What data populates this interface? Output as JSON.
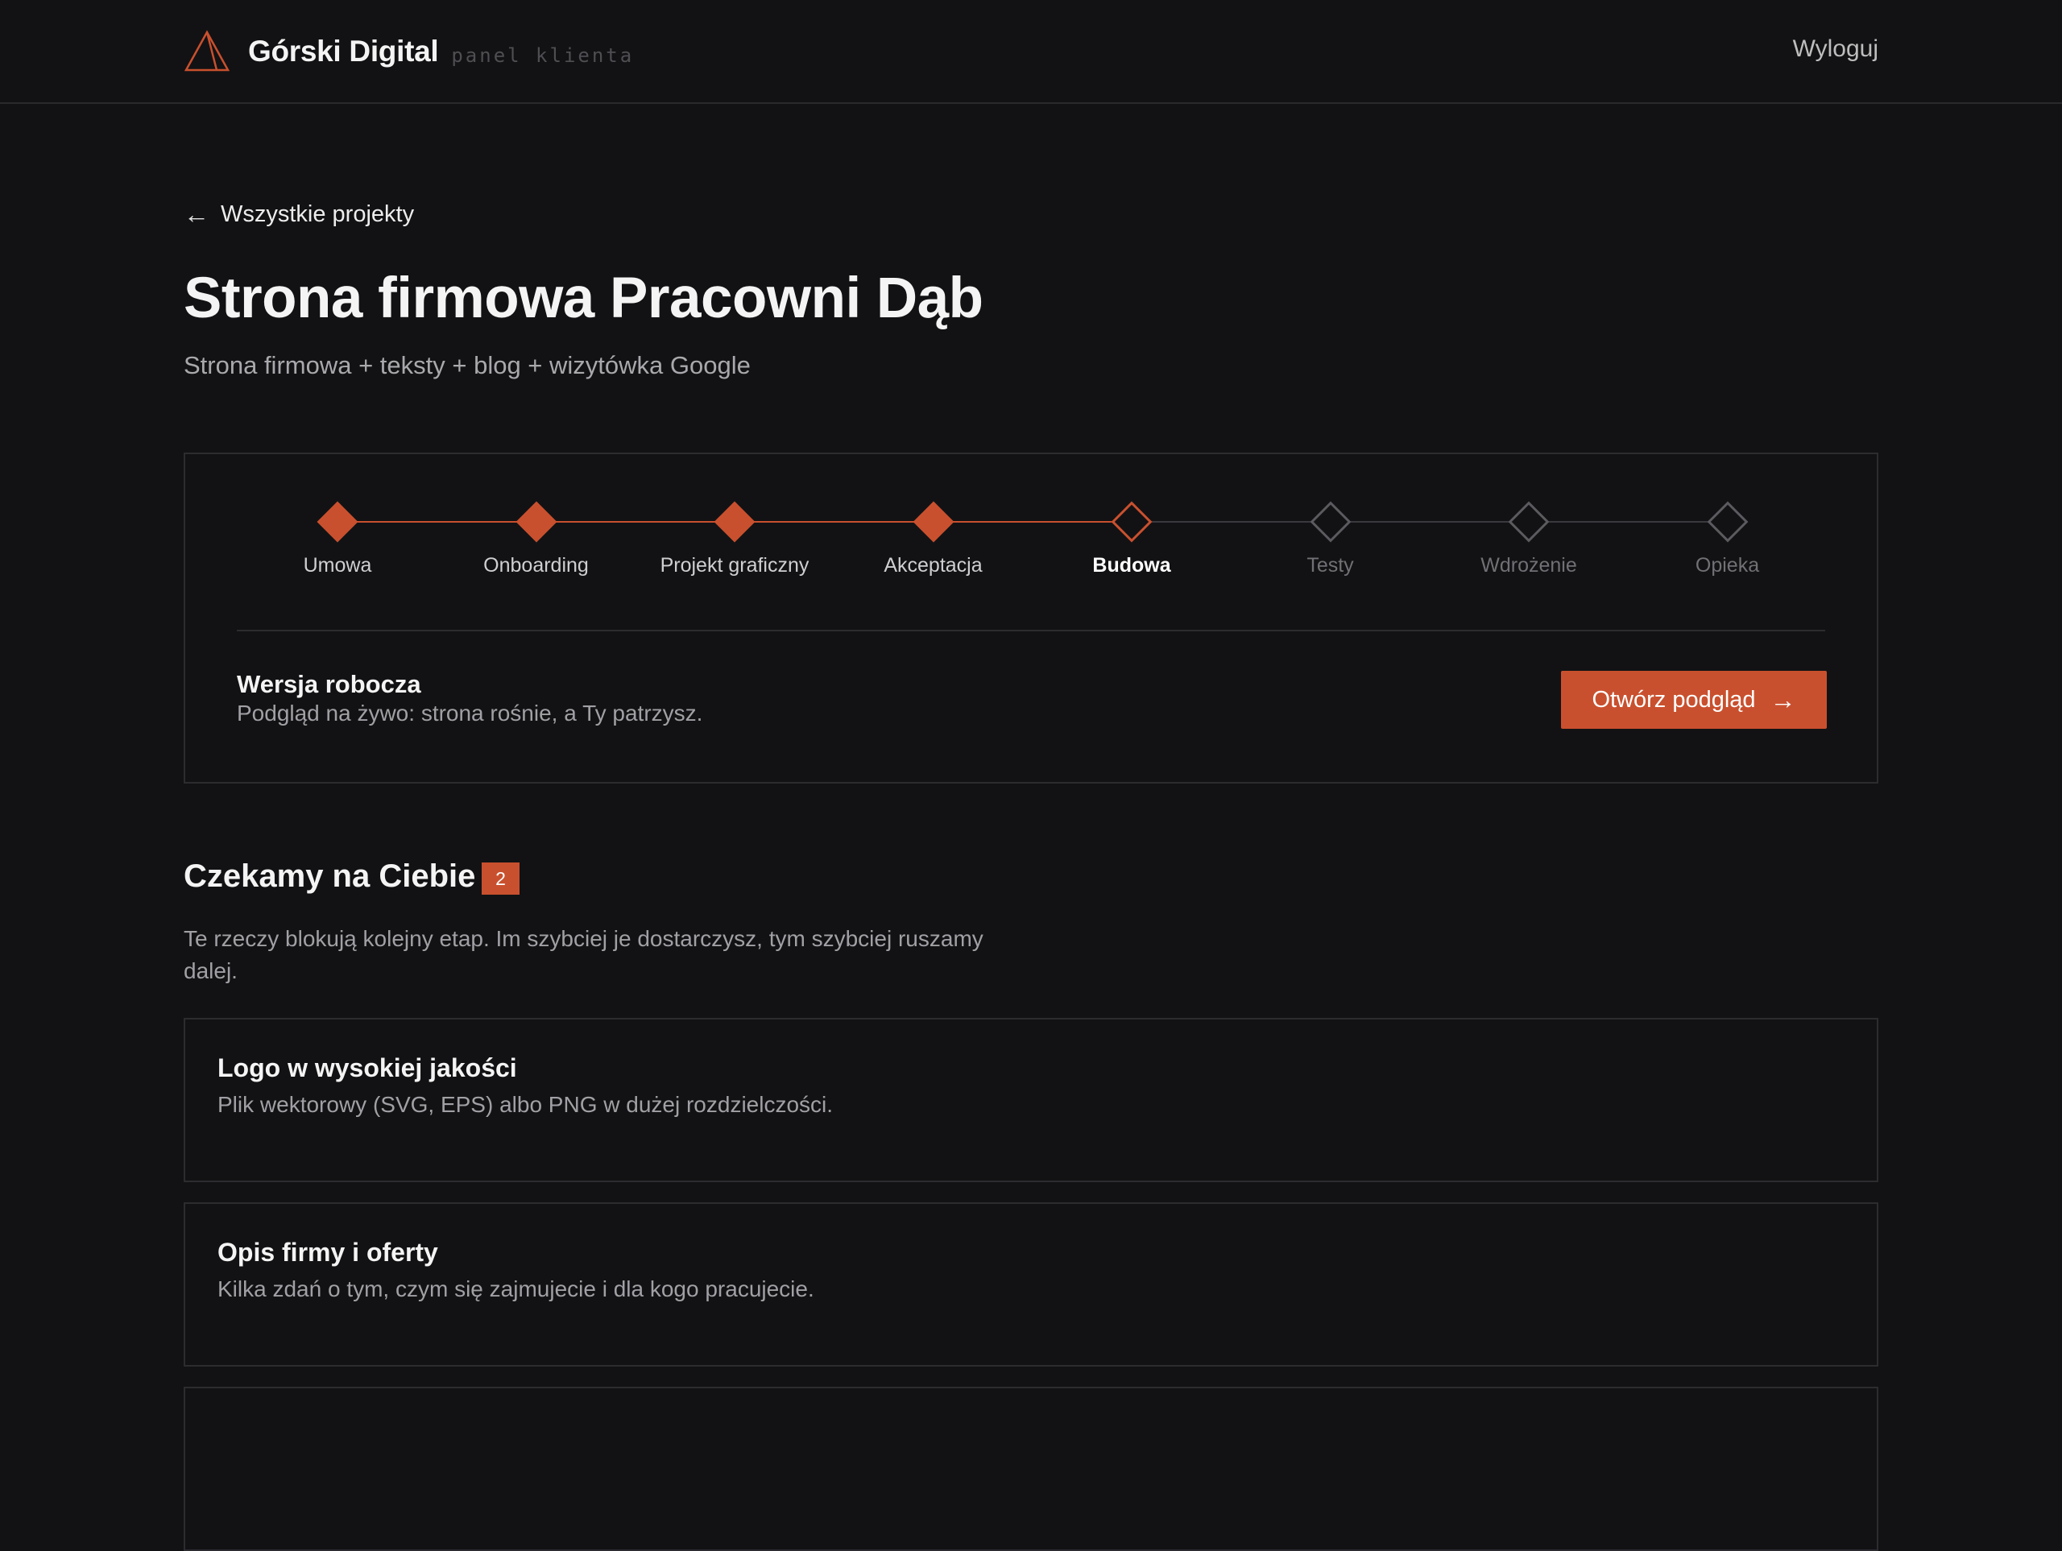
{
  "header": {
    "brand_name": "Górski Digital",
    "brand_tag": "panel klienta",
    "logout_label": "Wyloguj"
  },
  "back_link": {
    "arrow": "←",
    "label": "Wszystkie projekty"
  },
  "project": {
    "title": "Strona firmowa Pracowni Dąb",
    "subtitle": "Strona firmowa + teksty + blog + wizytówka Google"
  },
  "timeline": {
    "steps": [
      {
        "label": "Umowa",
        "state": "done"
      },
      {
        "label": "Onboarding",
        "state": "done"
      },
      {
        "label": "Projekt graficzny",
        "state": "done"
      },
      {
        "label": "Akceptacja",
        "state": "done"
      },
      {
        "label": "Budowa",
        "state": "current"
      },
      {
        "label": "Testy",
        "state": "todo"
      },
      {
        "label": "Wdrożenie",
        "state": "todo"
      },
      {
        "label": "Opieka",
        "state": "todo"
      }
    ]
  },
  "draft": {
    "title": "Wersja robocza",
    "description": "Podgląd na żywo: strona rośnie, a Ty patrzysz.",
    "button_label": "Otwórz podgląd",
    "button_arrow": "→"
  },
  "waiting": {
    "title": "Czekamy na Ciebie",
    "count": "2",
    "description": "Te rzeczy blokują kolejny etap. Im szybciej je dostarczysz, tym szybciej ruszamy dalej.",
    "tasks": [
      {
        "title": "Logo w wysokiej jakości",
        "description": "Plik wektorowy (SVG, EPS) albo PNG w dużej rozdzielczości."
      },
      {
        "title": "Opis firmy i oferty",
        "description": "Kilka zdań o tym, czym się zajmujecie i dla kogo pracujecie."
      }
    ]
  },
  "colors": {
    "background": "#121214",
    "accent": "#c9502e",
    "border": "#2c2c30",
    "muted_text": "#a0a0a5"
  },
  "icons": {
    "brand_logo": "triangle-logo-icon",
    "back": "arrow-left-icon",
    "preview": "arrow-right-icon",
    "step_done": "filled-diamond-icon",
    "step_current": "outlined-diamond-icon",
    "step_todo": "outlined-diamond-icon"
  }
}
